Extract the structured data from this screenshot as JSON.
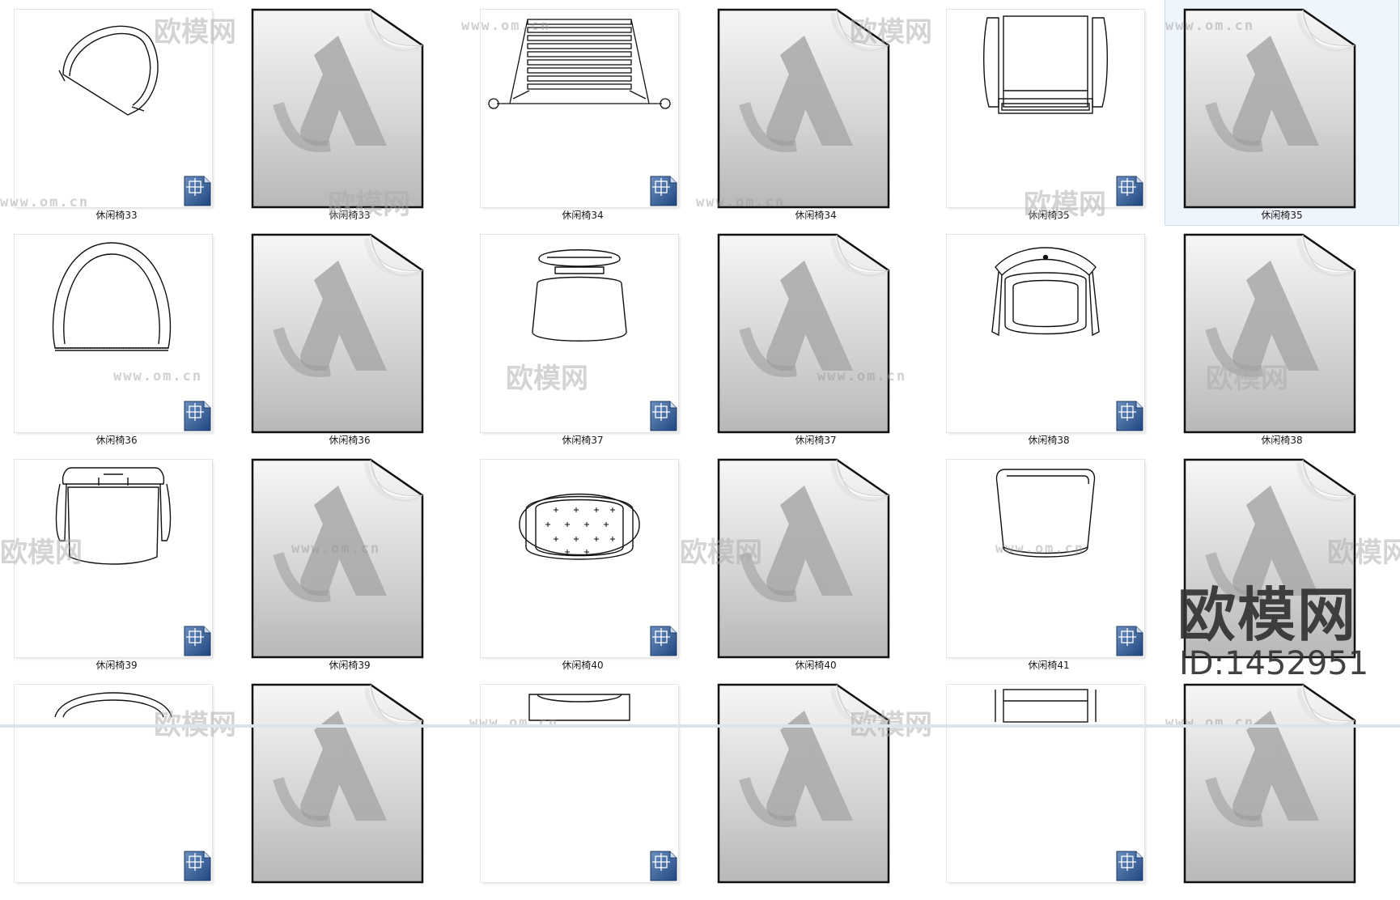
{
  "items": [
    {
      "label": "休闲椅33",
      "type": "dwg",
      "drawing": "d33"
    },
    {
      "label": "休闲椅33",
      "type": "doc"
    },
    {
      "label": "休闲椅34",
      "type": "dwg",
      "drawing": "d34"
    },
    {
      "label": "休闲椅34",
      "type": "doc"
    },
    {
      "label": "休闲椅35",
      "type": "dwg",
      "drawing": "d35"
    },
    {
      "label": "休闲椅35",
      "type": "doc",
      "selected": true
    },
    {
      "label": "休闲椅36",
      "type": "dwg",
      "drawing": "d36"
    },
    {
      "label": "休闲椅36",
      "type": "doc"
    },
    {
      "label": "休闲椅37",
      "type": "dwg",
      "drawing": "d37"
    },
    {
      "label": "休闲椅37",
      "type": "doc"
    },
    {
      "label": "休闲椅38",
      "type": "dwg",
      "drawing": "d38"
    },
    {
      "label": "休闲椅38",
      "type": "doc"
    },
    {
      "label": "休闲椅39",
      "type": "dwg",
      "drawing": "d39"
    },
    {
      "label": "休闲椅39",
      "type": "doc"
    },
    {
      "label": "休闲椅40",
      "type": "dwg",
      "drawing": "d40"
    },
    {
      "label": "休闲椅40",
      "type": "doc"
    },
    {
      "label": "休闲椅41",
      "type": "dwg",
      "drawing": "d41"
    },
    {
      "label": "",
      "type": "doc"
    },
    {
      "label": "",
      "type": "dwg",
      "drawing": "d42"
    },
    {
      "label": "",
      "type": "doc"
    },
    {
      "label": "",
      "type": "dwg",
      "drawing": "d43"
    },
    {
      "label": "",
      "type": "doc"
    },
    {
      "label": "",
      "type": "dwg",
      "drawing": "d44"
    },
    {
      "label": "",
      "type": "doc"
    }
  ],
  "watermark": {
    "url": "www.om.cn",
    "brand": "欧模网",
    "id": "ID:1452951"
  },
  "icons": {
    "dwg_badge": "cad-file-icon",
    "doc": "autodesk-document-icon"
  },
  "colors": {
    "selection": "#eef5fc",
    "badge": "#2d5a94",
    "doc_gray": "#bdbdbd"
  }
}
